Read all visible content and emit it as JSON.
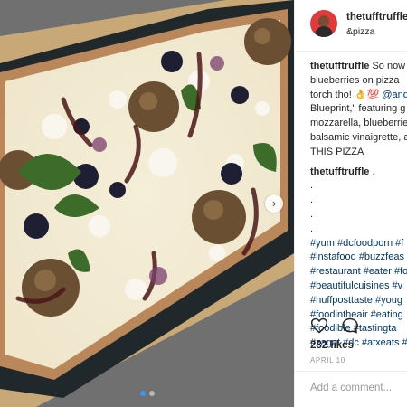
{
  "post": {
    "username": "thetufftruffle",
    "location": "&pizza",
    "avatar_color": "#e03a3a"
  },
  "caption": {
    "author": "thetufftruffle",
    "lines": [
      "So now",
      "blueberries on pizza",
      "torch tho!",
      "Blueprint,\" featuring g",
      "mozzarella, blueberrie",
      "balsamic vinaigrette, a",
      "THIS PIZZA"
    ],
    "emoji": "👌💯",
    "mention": "@and"
  },
  "comment": {
    "author": "thetufftruffle",
    "text": ".",
    "dots": [
      ".",
      ".",
      ".",
      "."
    ]
  },
  "hashtag_lines": [
    "#yum #dcfoodporn #f",
    "#instafood #buzzfeas",
    "#restaurant #eater #fo",
    "#beautifulcuisines #v",
    "#huffposttaste #youg",
    "#foodintheair #eating",
    "#foodible #tastingta",
    "#zagat #dc #atxeats #"
  ],
  "actions": {
    "like_icon": "heart-icon",
    "comment_icon": "comment-bubble-icon"
  },
  "likes": "282 likes",
  "date": "APRIL 10",
  "add_comment_placeholder": "Add a comment...",
  "carousel": {
    "next_glyph": "›",
    "slide_count": 2,
    "active_slide": 1,
    "active_color": "#3897f0"
  }
}
